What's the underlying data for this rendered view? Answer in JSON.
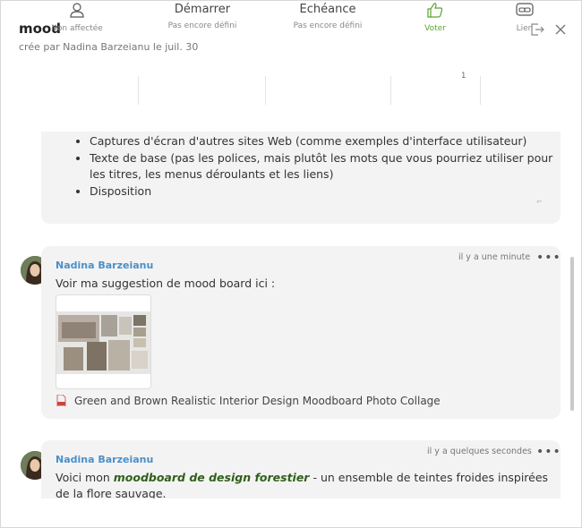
{
  "task": {
    "title": "mood",
    "subtitle": "crée par Nadina Barzeianu le juil. 30"
  },
  "header_icons": [
    "exit-icon",
    "close-icon"
  ],
  "toolbar": {
    "assignee": {
      "label": "Non affectée",
      "icon": "user-icon"
    },
    "start": {
      "label": "Démarrer",
      "sub": "Pas encore défini"
    },
    "due": {
      "label": "Echéance",
      "sub": "Pas encore défini"
    },
    "vote": {
      "label": "Voter",
      "count": "1",
      "icon": "thumbs-up-icon",
      "color": "#5aa52f"
    },
    "link": {
      "label": "Lien",
      "icon": "link-icon"
    }
  },
  "description": {
    "items": [
      "Captures d'écran d'autres sites Web (comme exemples d'interface utilisateur)",
      "Texte de base (pas les polices, mais plutôt les mots que vous pourriez utiliser pour les titres, les menus déroulants et les liens)",
      "Disposition"
    ]
  },
  "comments": [
    {
      "author": "Nadina Barzeianu",
      "time": "il y a une minute",
      "text": "Voir ma suggestion de mood board ici :",
      "attachment": "Green and Brown Realistic Interior Design Moodboard Photo Collage"
    },
    {
      "author": "Nadina Barzeianu",
      "time": "il y a quelques secondes",
      "text_before": "Voici mon ",
      "text_bold": "moodboard de design forestier",
      "text_after": " - un ensemble de teintes froides inspirées de la flore sauvage."
    }
  ],
  "more_label": "•••",
  "colors": {
    "author": "#4a90c8",
    "vote": "#5aa52f",
    "card_bg": "#f4f3f3"
  }
}
